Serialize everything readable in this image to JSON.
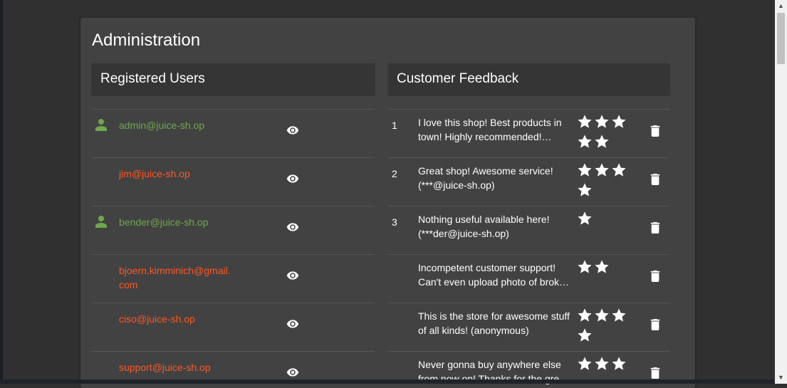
{
  "page": {
    "title": "Administration"
  },
  "users": {
    "header": "Registered Users",
    "rows": [
      {
        "email": "admin@juice-sh.op",
        "role": "admin"
      },
      {
        "email": "jim@juice-sh.op",
        "role": "customer"
      },
      {
        "email": "bender@juice-sh.op",
        "role": "admin"
      },
      {
        "email": "bjoern.kimminich@gmail.com",
        "role": "customer"
      },
      {
        "email": "ciso@juice-sh.op",
        "role": "customer"
      },
      {
        "email": "support@juice-sh.op",
        "role": "customer"
      }
    ]
  },
  "feedback": {
    "header": "Customer Feedback",
    "rows": [
      {
        "id": "1",
        "comment": "I love this shop! Best products in town! Highly recommended! (***in@juice-sh.op)",
        "rating": 5
      },
      {
        "id": "2",
        "comment": "Great shop! Awesome service! (***@juice-sh.op)",
        "rating": 4
      },
      {
        "id": "3",
        "comment": "Nothing useful available here! (***der@juice-sh.op)",
        "rating": 1
      },
      {
        "id": "",
        "comment": "Incompetent customer support! Can't even upload photo of broken purchase!",
        "rating": 2
      },
      {
        "id": "",
        "comment": "This is the store for awesome stuff of all kinds! (anonymous)",
        "rating": 4
      },
      {
        "id": "",
        "comment": "Never gonna buy anywhere else from now on! Thanks for the great service! (anonymous)",
        "rating": 3
      }
    ]
  },
  "colors": {
    "background": "#303030",
    "card": "#424242",
    "admin_email": "#6ea84a",
    "user_email": "#ff5722"
  },
  "icons": {
    "user": "person-icon",
    "view": "eye-icon",
    "delete": "trash-icon",
    "rating": "star-icon"
  }
}
